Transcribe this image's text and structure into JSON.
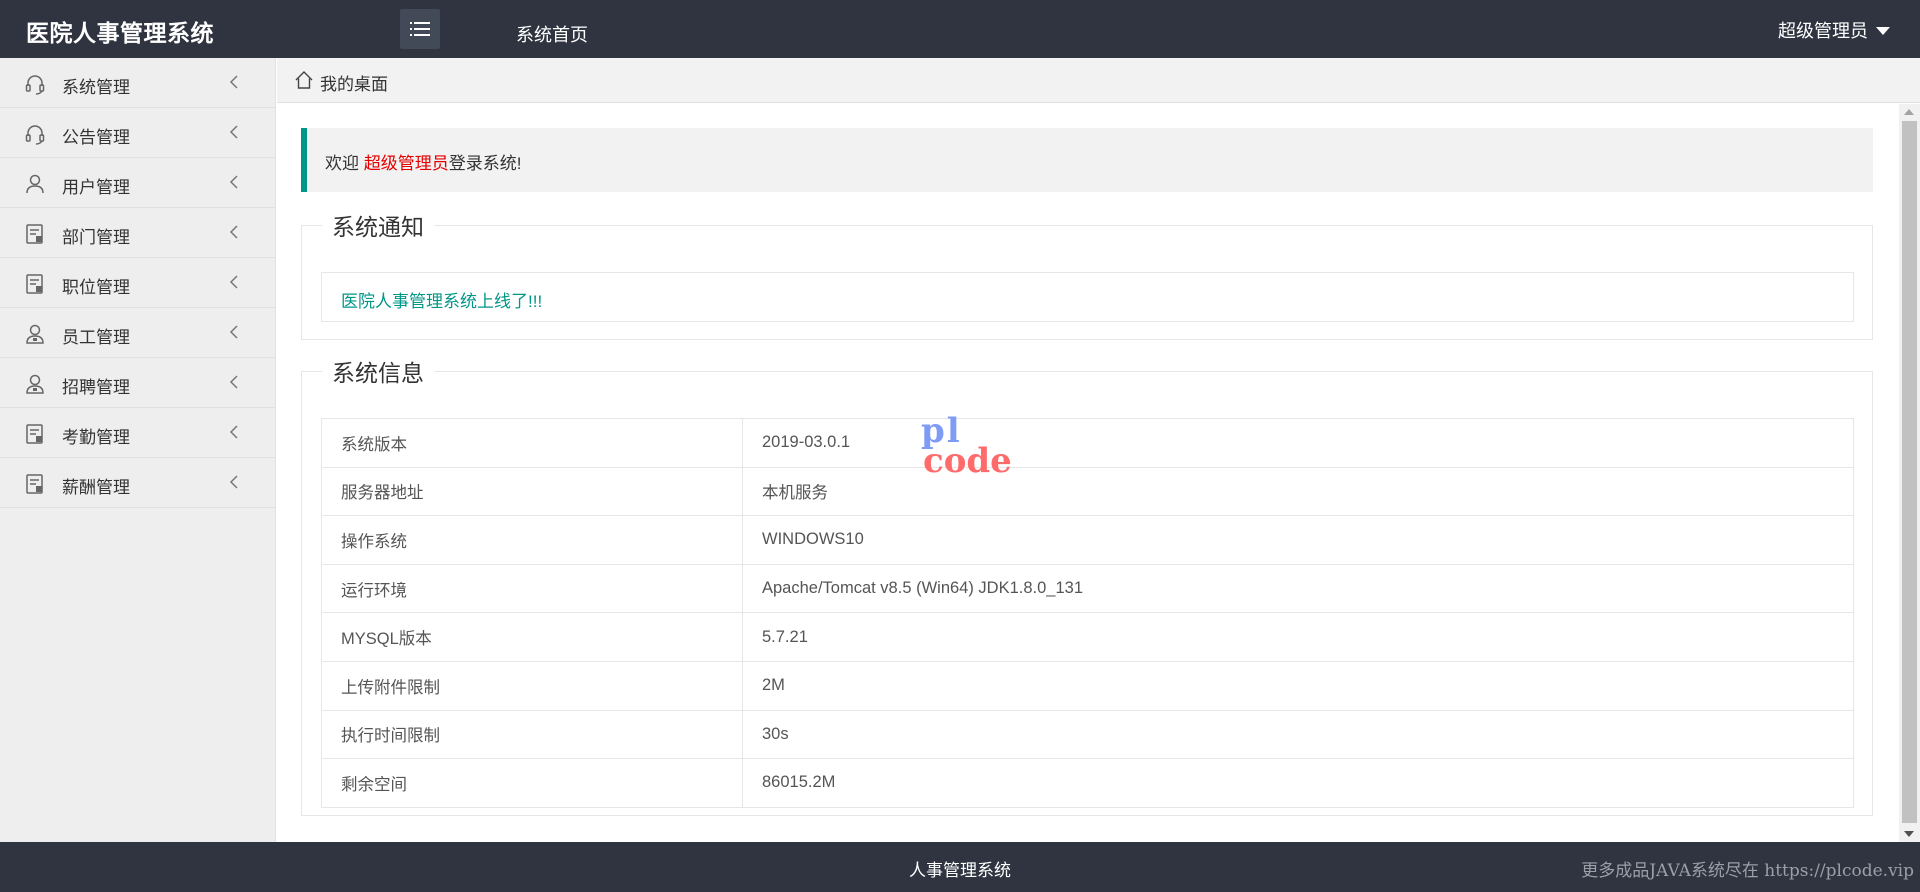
{
  "header": {
    "app_title": "医院人事管理系统",
    "home_tab": "系统首页",
    "user_name": "超级管理员",
    "menu_icon": "list-icon"
  },
  "sidebar": {
    "items": [
      {
        "label": "系统管理",
        "icon": "headset-icon"
      },
      {
        "label": "公告管理",
        "icon": "headset-icon"
      },
      {
        "label": "用户管理",
        "icon": "user-icon"
      },
      {
        "label": "部门管理",
        "icon": "document-icon"
      },
      {
        "label": "职位管理",
        "icon": "document-icon"
      },
      {
        "label": "员工管理",
        "icon": "user-badge-icon"
      },
      {
        "label": "招聘管理",
        "icon": "user-badge-icon"
      },
      {
        "label": "考勤管理",
        "icon": "document-icon"
      },
      {
        "label": "薪酬管理",
        "icon": "document-icon"
      }
    ]
  },
  "breadcrumb": {
    "icon": "home-icon",
    "label": "我的桌面"
  },
  "welcome": {
    "prefix": "欢迎 ",
    "user": "超级管理员",
    "suffix": "登录系统!"
  },
  "notice": {
    "legend": "系统通知",
    "message": "医院人事管理系统上线了!!!"
  },
  "system_info": {
    "legend": "系统信息",
    "rows": [
      {
        "key": "系统版本",
        "value": "2019-03.0.1"
      },
      {
        "key": "服务器地址",
        "value": "本机服务"
      },
      {
        "key": "操作系统",
        "value": "WINDOWS10"
      },
      {
        "key": "运行环境",
        "value": "Apache/Tomcat v8.5 (Win64) JDK1.8.0_131"
      },
      {
        "key": "MYSQL版本",
        "value": "5.7.21"
      },
      {
        "key": "上传附件限制",
        "value": "2M"
      },
      {
        "key": "执行时间限制",
        "value": "30s"
      },
      {
        "key": "剩余空间",
        "value": "86015.2M"
      }
    ]
  },
  "watermark": {
    "line1": "pl",
    "line2": "code"
  },
  "footer": {
    "text": "人事管理系统",
    "promo": "更多成品JAVA系统尽在 https://plcode.vip"
  },
  "colors": {
    "header_bg": "#2f3440",
    "accent": "#009688",
    "highlight_red": "#e60000",
    "sidebar_bg": "#eeeeee"
  }
}
